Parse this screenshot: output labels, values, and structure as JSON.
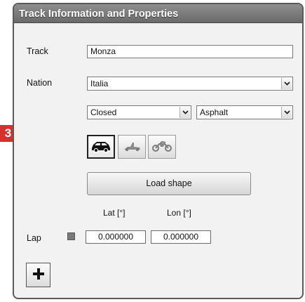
{
  "window": {
    "title": "Track Information and Properties"
  },
  "track": {
    "label": "Track",
    "value": "Monza"
  },
  "nation": {
    "label": "Nation",
    "selected": "Italia"
  },
  "circuit_type": {
    "selected": "Closed"
  },
  "surface": {
    "selected": "Asphalt"
  },
  "vehicle_types": [
    {
      "icon": "car-icon",
      "selected": true
    },
    {
      "icon": "kart-icon",
      "selected": false
    },
    {
      "icon": "motorbike-icon",
      "selected": false
    }
  ],
  "load_shape_label": "Load shape",
  "coords": {
    "lat_header": "Lat [°]",
    "lon_header": "Lon [°]",
    "row_label": "Lap",
    "lat_value": "0.000000",
    "lon_value": "0.000000",
    "swatch_color": "#7a7a7a"
  },
  "add_button_icon": "plus-icon",
  "step_badge": "3",
  "colors": {
    "title_bar": "#7b7b7b",
    "badge": "#d6312e",
    "window_bg": "#f2f2f2"
  }
}
